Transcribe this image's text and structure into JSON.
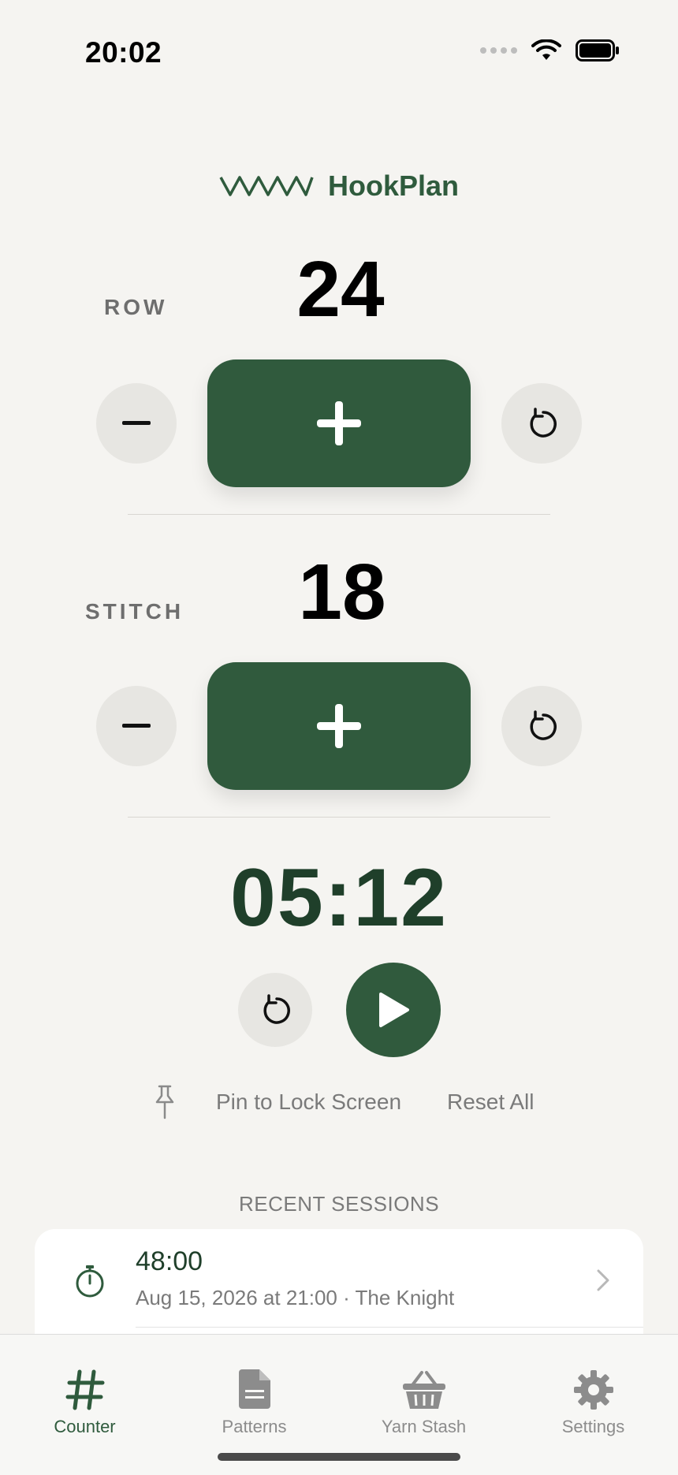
{
  "status_bar": {
    "time": "20:02"
  },
  "app": {
    "name": "HookPlan"
  },
  "counters": [
    {
      "label": "ROW",
      "value": "24"
    },
    {
      "label": "STITCH",
      "value": "18"
    }
  ],
  "timer": {
    "display": "05:12"
  },
  "actions": {
    "pin_label": "Pin to Lock Screen",
    "reset_all_label": "Reset All"
  },
  "recent": {
    "title": "RECENT SESSIONS",
    "sessions": [
      {
        "duration": "48:00",
        "detail": "Aug 15, 2026 at 21:00 · The Knight"
      }
    ]
  },
  "tabs": [
    {
      "label": "Counter",
      "icon": "hash-icon",
      "active": true
    },
    {
      "label": "Patterns",
      "icon": "document-icon",
      "active": false
    },
    {
      "label": "Yarn Stash",
      "icon": "basket-icon",
      "active": false
    },
    {
      "label": "Settings",
      "icon": "gear-icon",
      "active": false
    }
  ],
  "colors": {
    "accent": "#305a3d",
    "background": "#f5f4f1",
    "muted": "#7a7a7a"
  }
}
